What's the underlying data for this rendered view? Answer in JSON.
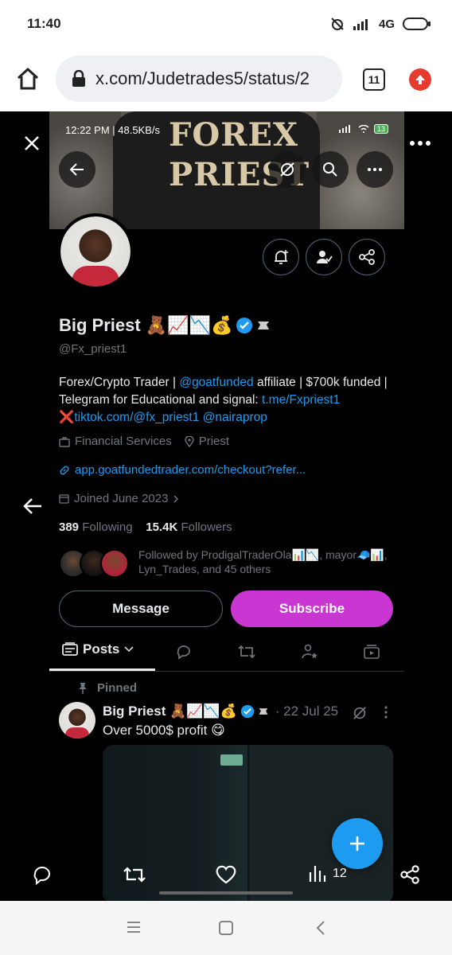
{
  "status_bar": {
    "time": "11:40",
    "network": "4G",
    "network_sub": "ıl"
  },
  "browser": {
    "url": "x.com/Judetrades5/status/2",
    "tab_count": "11"
  },
  "banner": {
    "word1": "FOREX",
    "word2": "PRIEST",
    "inner_time": "12:22 PM | 48.5KB/s",
    "inner_battery": "13"
  },
  "profile": {
    "name": "Big Priest 🧸📈📉💰",
    "handle": "@Fx_priest1",
    "bio_1": "Forex/Crypto Trader | ",
    "bio_link1": "@goatfunded",
    "bio_2": " affiliate | $700k funded | Telegram for Educational and signal: ",
    "bio_link2": "t.me/Fxpriest1",
    "bio_3": " ❌",
    "bio_link3": "tiktok.com/@fx_priest1",
    "bio_4": " ",
    "bio_link4": "@nairaprop",
    "category": "Financial Services",
    "location": "Priest",
    "website": "app.goatfundedtrader.com/checkout?refer...",
    "joined": "Joined June 2023",
    "following_count": "389",
    "following_label": "Following",
    "followers_count": "15.4K",
    "followers_label": "Followers",
    "followed_by": "Followed by ProdigalTraderOla📊📉, mayor🧢📊, Lyn_Trades, and 45 others",
    "message_label": "Message",
    "subscribe_label": "Subscribe"
  },
  "tabs": {
    "posts_label": "Posts"
  },
  "post": {
    "pinned_label": "Pinned",
    "author": "Big Priest 🧸📈📉💰",
    "date": "· 22 Jul 25",
    "text": "Over 5000$ profit 😋"
  },
  "viewer_actions": {
    "views_count": "12"
  },
  "colors": {
    "accent_blue": "#1d9bf0",
    "subscribe_purple": "#c936d2",
    "dark_bg": "#000000"
  }
}
